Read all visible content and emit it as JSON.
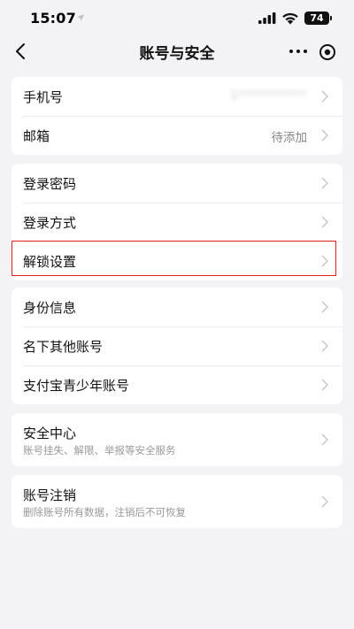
{
  "status_bar": {
    "time": "15:07",
    "battery": "74"
  },
  "nav": {
    "title": "账号与安全"
  },
  "groups": [
    {
      "items": [
        {
          "label": "手机号",
          "value": "1**********"
        },
        {
          "label": "邮箱",
          "value": "待添加"
        }
      ]
    },
    {
      "items": [
        {
          "label": "登录密码"
        },
        {
          "label": "登录方式"
        },
        {
          "label": "解锁设置"
        }
      ]
    },
    {
      "items": [
        {
          "label": "身份信息"
        },
        {
          "label": "名下其他账号"
        },
        {
          "label": "支付宝青少年账号"
        }
      ]
    },
    {
      "items": [
        {
          "label": "安全中心",
          "subtitle": "账号挂失、解限、举报等安全服务"
        }
      ]
    },
    {
      "items": [
        {
          "label": "账号注销",
          "subtitle": "删除账号所有数据，注销后不可恢复"
        }
      ]
    }
  ],
  "colors": {
    "background": "#f3f3f5",
    "card": "#ffffff",
    "highlight": "#e0201e"
  }
}
